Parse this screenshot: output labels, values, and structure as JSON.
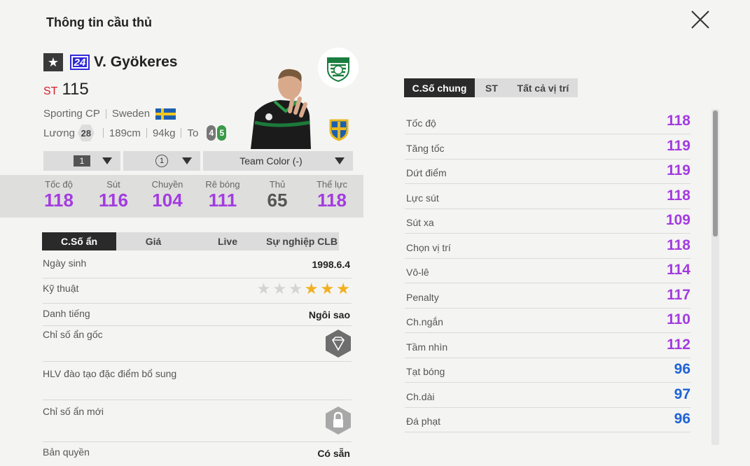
{
  "header": {
    "title": "Thông tin cầu thủ"
  },
  "player": {
    "season_badge": "24",
    "name": "V. Gyökeres",
    "position": "ST",
    "overall": "115",
    "club": "Sporting CP",
    "nation": "Sweden",
    "salary_label": "Lương",
    "salary": "28",
    "height": "189cm",
    "weight": "94kg",
    "body_type": "To",
    "weak_foot_left": "4",
    "weak_foot_right": "5"
  },
  "dropdowns": {
    "level": "1",
    "team_badge": "1",
    "team_color": "Team Color (-)"
  },
  "summary_stats": [
    {
      "label": "Tốc độ",
      "value": "118",
      "color": "#a33be0"
    },
    {
      "label": "Sút",
      "value": "116",
      "color": "#a33be0"
    },
    {
      "label": "Chuyền",
      "value": "104",
      "color": "#a33be0"
    },
    {
      "label": "Rê bóng",
      "value": "111",
      "color": "#a33be0"
    },
    {
      "label": "Thủ",
      "value": "65",
      "color": "#555555"
    },
    {
      "label": "Thể lực",
      "value": "118",
      "color": "#a33be0"
    }
  ],
  "left_tabs": [
    "C.Số ẩn",
    "Giá",
    "Live",
    "Sự nghiệp CLB"
  ],
  "left_rows": {
    "birthday_label": "Ngày sinh",
    "birthday": "1998.6.4",
    "skill_label": "Kỹ thuật",
    "skill_stars": 3,
    "reputation_label": "Danh tiếng",
    "reputation": "Ngôi sao",
    "hidden_orig_label": "Chỉ số ẩn gốc",
    "coach_label": "HLV đào tạo đặc điểm bổ sung",
    "hidden_new_label": "Chỉ số ẩn mới",
    "license_label": "Bản quyền",
    "license": "Có sẵn"
  },
  "right_tabs": [
    "C.Số chung",
    "ST",
    "Tất cả vị trí"
  ],
  "attributes": [
    {
      "label": "Tốc độ",
      "value": "118",
      "color": "#a33be0"
    },
    {
      "label": "Tăng tốc",
      "value": "119",
      "color": "#a33be0"
    },
    {
      "label": "Dứt điểm",
      "value": "119",
      "color": "#a33be0"
    },
    {
      "label": "Lực sút",
      "value": "118",
      "color": "#a33be0"
    },
    {
      "label": "Sút xa",
      "value": "109",
      "color": "#a33be0"
    },
    {
      "label": "Chọn vị trí",
      "value": "118",
      "color": "#a33be0"
    },
    {
      "label": "Vô-lê",
      "value": "114",
      "color": "#a33be0"
    },
    {
      "label": "Penalty",
      "value": "117",
      "color": "#a33be0"
    },
    {
      "label": "Ch.ngắn",
      "value": "110",
      "color": "#a33be0"
    },
    {
      "label": "Tầm nhìn",
      "value": "112",
      "color": "#a33be0"
    },
    {
      "label": "Tạt bóng",
      "value": "96",
      "color": "#1f62d6"
    },
    {
      "label": "Ch.dài",
      "value": "97",
      "color": "#1f62d6"
    },
    {
      "label": "Đá phạt",
      "value": "96",
      "color": "#1f62d6"
    }
  ]
}
